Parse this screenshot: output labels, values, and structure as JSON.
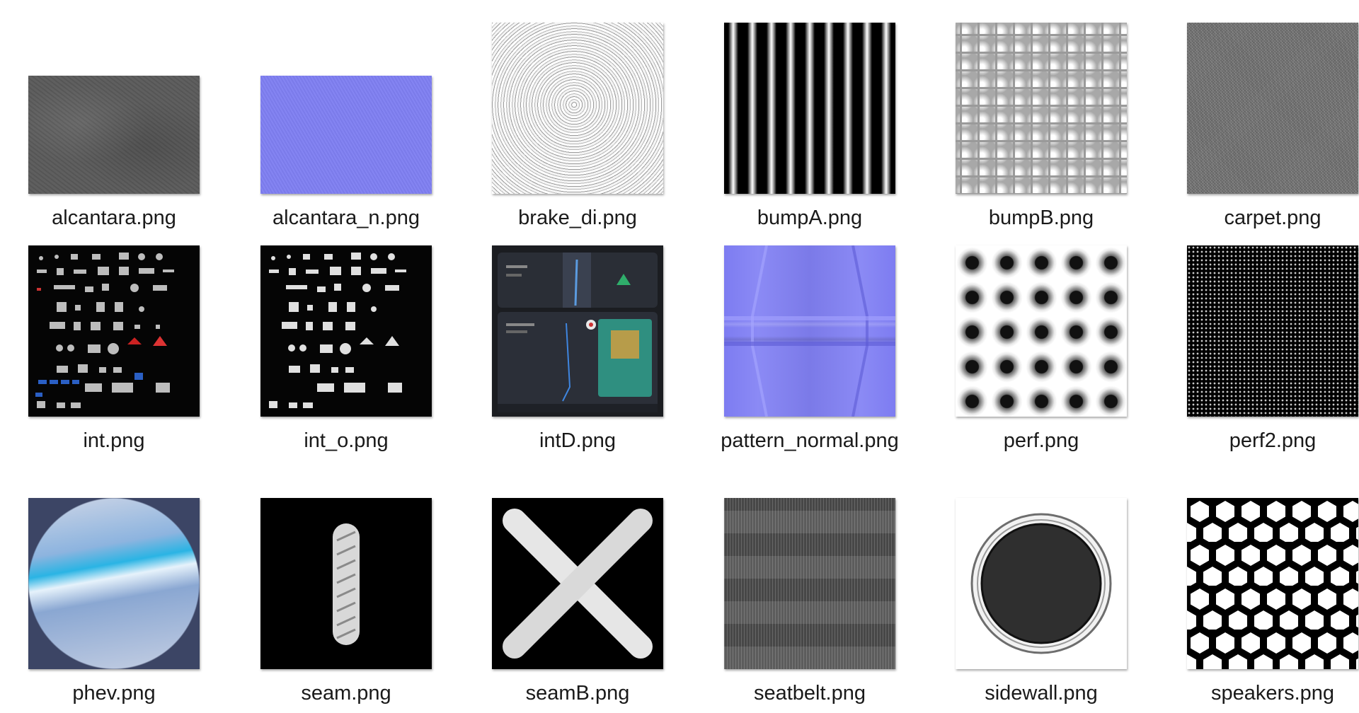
{
  "files": [
    {
      "name": "alcantara.png",
      "texture": "alcantara"
    },
    {
      "name": "alcantara_n.png",
      "texture": "alcantara-n"
    },
    {
      "name": "brake_di.png",
      "texture": "brake"
    },
    {
      "name": "bumpA.png",
      "texture": "bumpA"
    },
    {
      "name": "bumpB.png",
      "texture": "bumpB"
    },
    {
      "name": "carpet.png",
      "texture": "carpet"
    },
    {
      "name": "int.png",
      "texture": "int"
    },
    {
      "name": "int_o.png",
      "texture": "int-o"
    },
    {
      "name": "intD.png",
      "texture": "intD"
    },
    {
      "name": "pattern_normal.png",
      "texture": "pattern"
    },
    {
      "name": "perf.png",
      "texture": "perf"
    },
    {
      "name": "perf2.png",
      "texture": "perf2"
    },
    {
      "name": "phev.png",
      "texture": "phev"
    },
    {
      "name": "seam.png",
      "texture": "seam"
    },
    {
      "name": "seamB.png",
      "texture": "seamB"
    },
    {
      "name": "seatbelt.png",
      "texture": "seatbelt"
    },
    {
      "name": "sidewall.png",
      "texture": "sidewall"
    },
    {
      "name": "speakers.png",
      "texture": "speakers"
    }
  ]
}
